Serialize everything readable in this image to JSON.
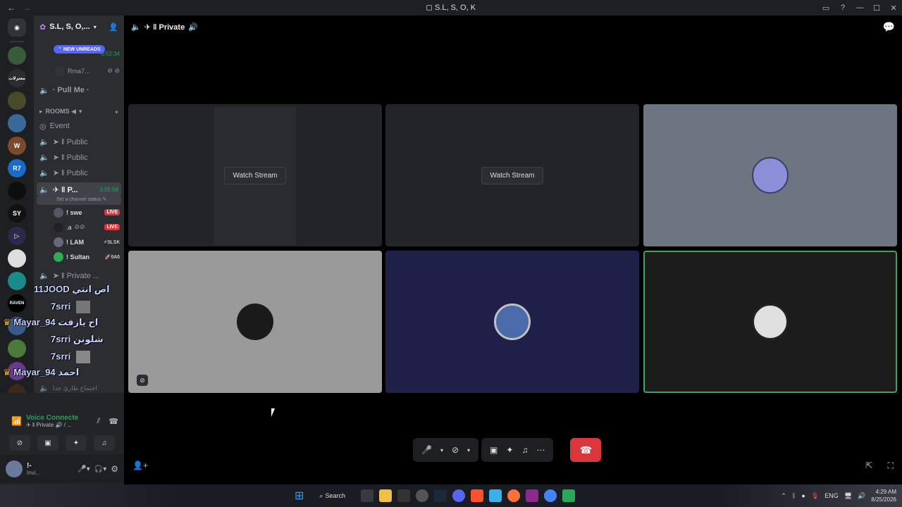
{
  "window": {
    "title": "S.L, S, O, K",
    "back": "←",
    "forward": "→"
  },
  "guild": {
    "name": "S.L, S, O,...",
    "new_unreads": "NEW UNREADS"
  },
  "channels_top": [
    {
      "label": "Rma7...",
      "kind": "user"
    },
    {
      "label": "· Pull Me ·",
      "kind": "voice"
    }
  ],
  "timer_top": "6:52:34",
  "rooms_category": "ROOMS ◀",
  "room_channels": [
    {
      "label": "Event",
      "icon": "stage-icon"
    },
    {
      "label": "➤ ‖ Public",
      "icon": "speaker-icon"
    },
    {
      "label": "➤ ‖ Public",
      "icon": "speaker-icon"
    },
    {
      "label": "➤ ‖ Public",
      "icon": "speaker-icon"
    }
  ],
  "active_channel": {
    "label": "✈ ‖ P...",
    "timer": "3:05:58",
    "status_hint": "Set a channel status"
  },
  "voice_users": [
    {
      "name": "! swe",
      "badge": "LIVE"
    },
    {
      "name": ".a",
      "badge": "LIVE"
    },
    {
      "name": "! LAM",
      "badge": "⚡SLSK"
    },
    {
      "name": "! Sultan",
      "badge": "🚀6A6"
    }
  ],
  "private_channel": "➤ ‖ Private ...",
  "dim_channel": "اجتماع طارئ جدا",
  "overlay_chat": [
    {
      "user": "11JOOD",
      "text": "اص انتي"
    },
    {
      "user": "7srri",
      "text": ""
    },
    {
      "user": "Mayar_94",
      "text": "اح يازفت"
    },
    {
      "user": "7srri",
      "text": "شلونن"
    },
    {
      "user": "7srri",
      "text": ""
    },
    {
      "user": "Mayar_94",
      "text": "احمد"
    }
  ],
  "voice_panel": {
    "status": "Voice Connecte",
    "channel": "✈ ‖ Private 🔊 / ...",
    "user_name": "!-",
    "user_status": "Invi..."
  },
  "main_header": {
    "channel": "✈ ‖ Private"
  },
  "tiles": [
    {
      "kind": "stream",
      "button": "Watch Stream",
      "bg": "#232428"
    },
    {
      "kind": "stream",
      "button": "Watch Stream",
      "bg": "#232428"
    },
    {
      "kind": "avatar",
      "bg": "#6d7680"
    },
    {
      "kind": "avatar",
      "bg": "#9a9a9a"
    },
    {
      "kind": "avatar",
      "bg": "#1f1f4a"
    },
    {
      "kind": "avatar",
      "bg": "#1c1c1c",
      "speaking": true
    }
  ],
  "colors": {
    "accent": "#5865f2",
    "danger": "#da373c",
    "speaking": "#3ba55d",
    "online": "#23a55a"
  },
  "taskbar": {
    "search": "Search",
    "lang": "ENG",
    "time": "4:29 AM",
    "date": "8/25/2026"
  }
}
